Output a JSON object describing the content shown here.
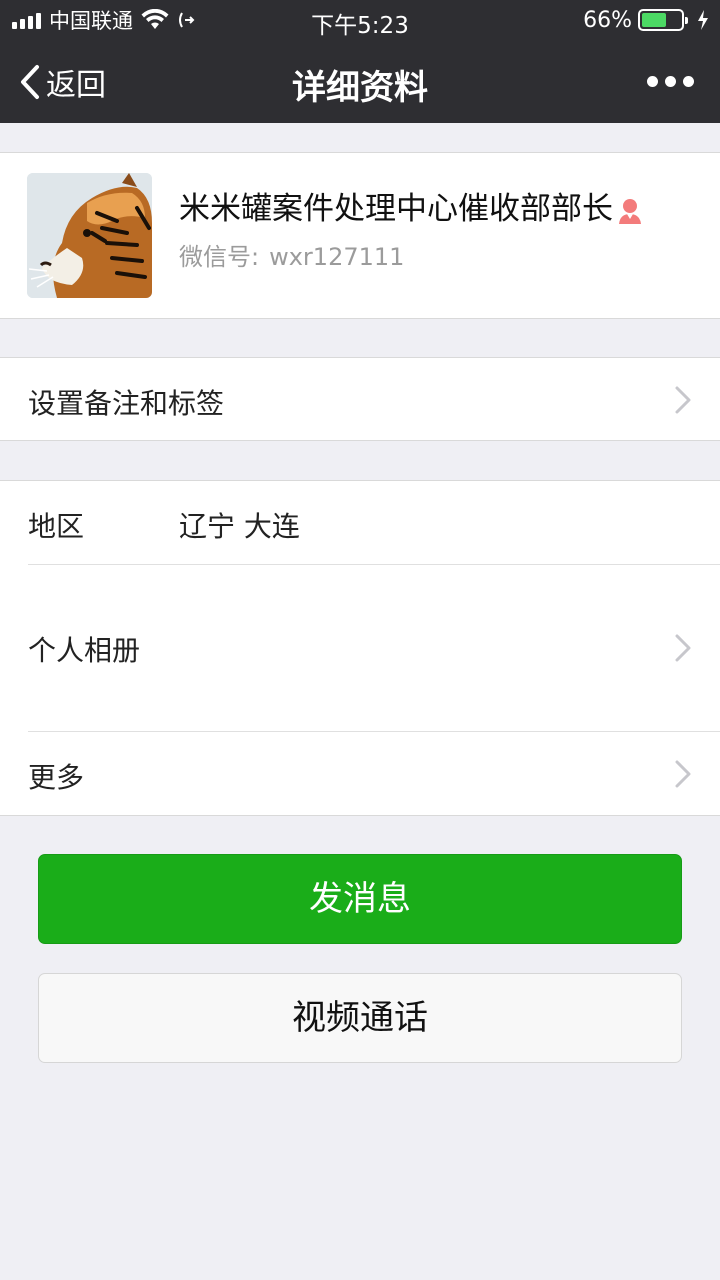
{
  "status_bar": {
    "carrier": "中国联通",
    "time": "下午5:23",
    "battery_percent": "66%",
    "battery_level": 0.66
  },
  "nav": {
    "back_label": "返回",
    "title": "详细资料"
  },
  "profile": {
    "nickname": "米米罐案件处理中心催收部部长",
    "wechat_id_label": "微信号:",
    "wechat_id": "wxr127111"
  },
  "rows": {
    "remark_tags": "设置备注和标签",
    "region_label": "地区",
    "region_value": "辽宁 大连",
    "album_label": "个人相册",
    "more_label": "更多"
  },
  "buttons": {
    "send_message": "发消息",
    "video_call": "视频通话"
  },
  "colors": {
    "header_bg": "#2e2e32",
    "primary_green": "#1aad19",
    "page_bg": "#efeff4",
    "gender_icon": "#f37b7b"
  }
}
